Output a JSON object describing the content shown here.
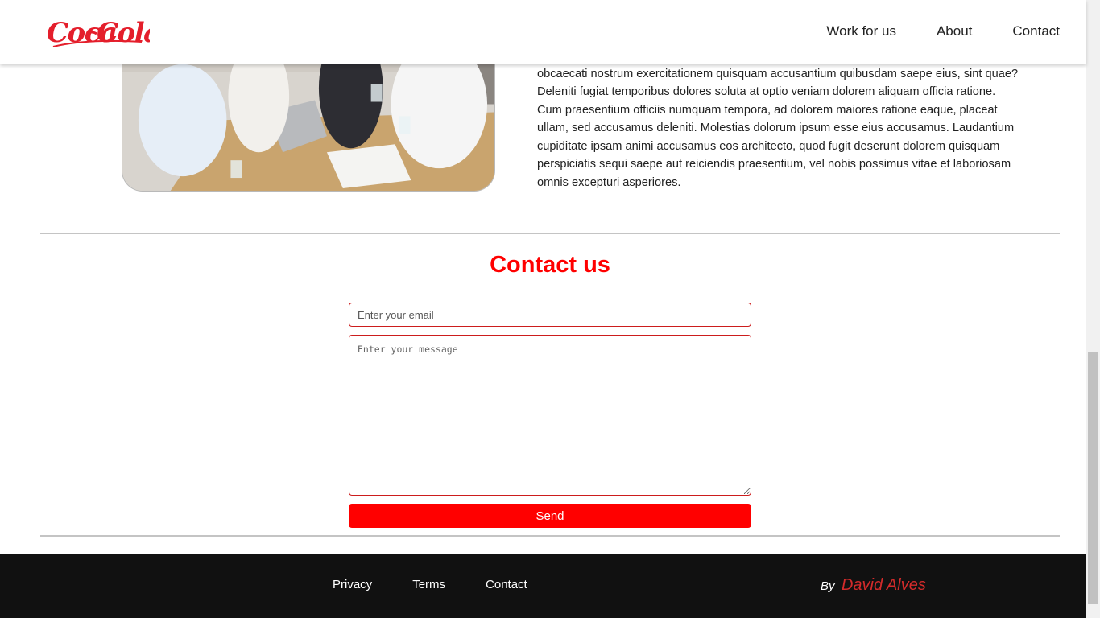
{
  "header": {
    "logo_text": "Coca-Cola",
    "nav": [
      "Work for us",
      "About",
      "Contact"
    ]
  },
  "about": {
    "paragraph_visible": "obcaecati nostrum exercitationem quisquam accusantium quibusdam saepe eius, sint quae? Deleniti fugiat temporibus dolores soluta at optio veniam dolorem aliquam officia ratione. Cum praesentium officiis numquam tempora, ad dolorem maiores ratione eaque, placeat ullam, sed accusamus deleniti. Molestias dolorum ipsum esse eius accusamus. Laudantium cupiditate ipsam animi accusamus eos architecto, quod fugit deserunt dolorem quisquam perspiciatis sequi saepe aut reiciendis praesentium, vel nobis possimus vitae et laboriosam omnis excepturi asperiores."
  },
  "contact": {
    "title": "Contact us",
    "email_placeholder": "Enter your email",
    "message_placeholder": "Enter your message",
    "send_label": "Send"
  },
  "footer": {
    "links": [
      "Privacy",
      "Terms",
      "Contact"
    ],
    "by_label": "By",
    "author": "David Alves"
  },
  "colors": {
    "accent": "#ff0000",
    "footer_bg": "#111111",
    "author": "#d42b2b"
  }
}
